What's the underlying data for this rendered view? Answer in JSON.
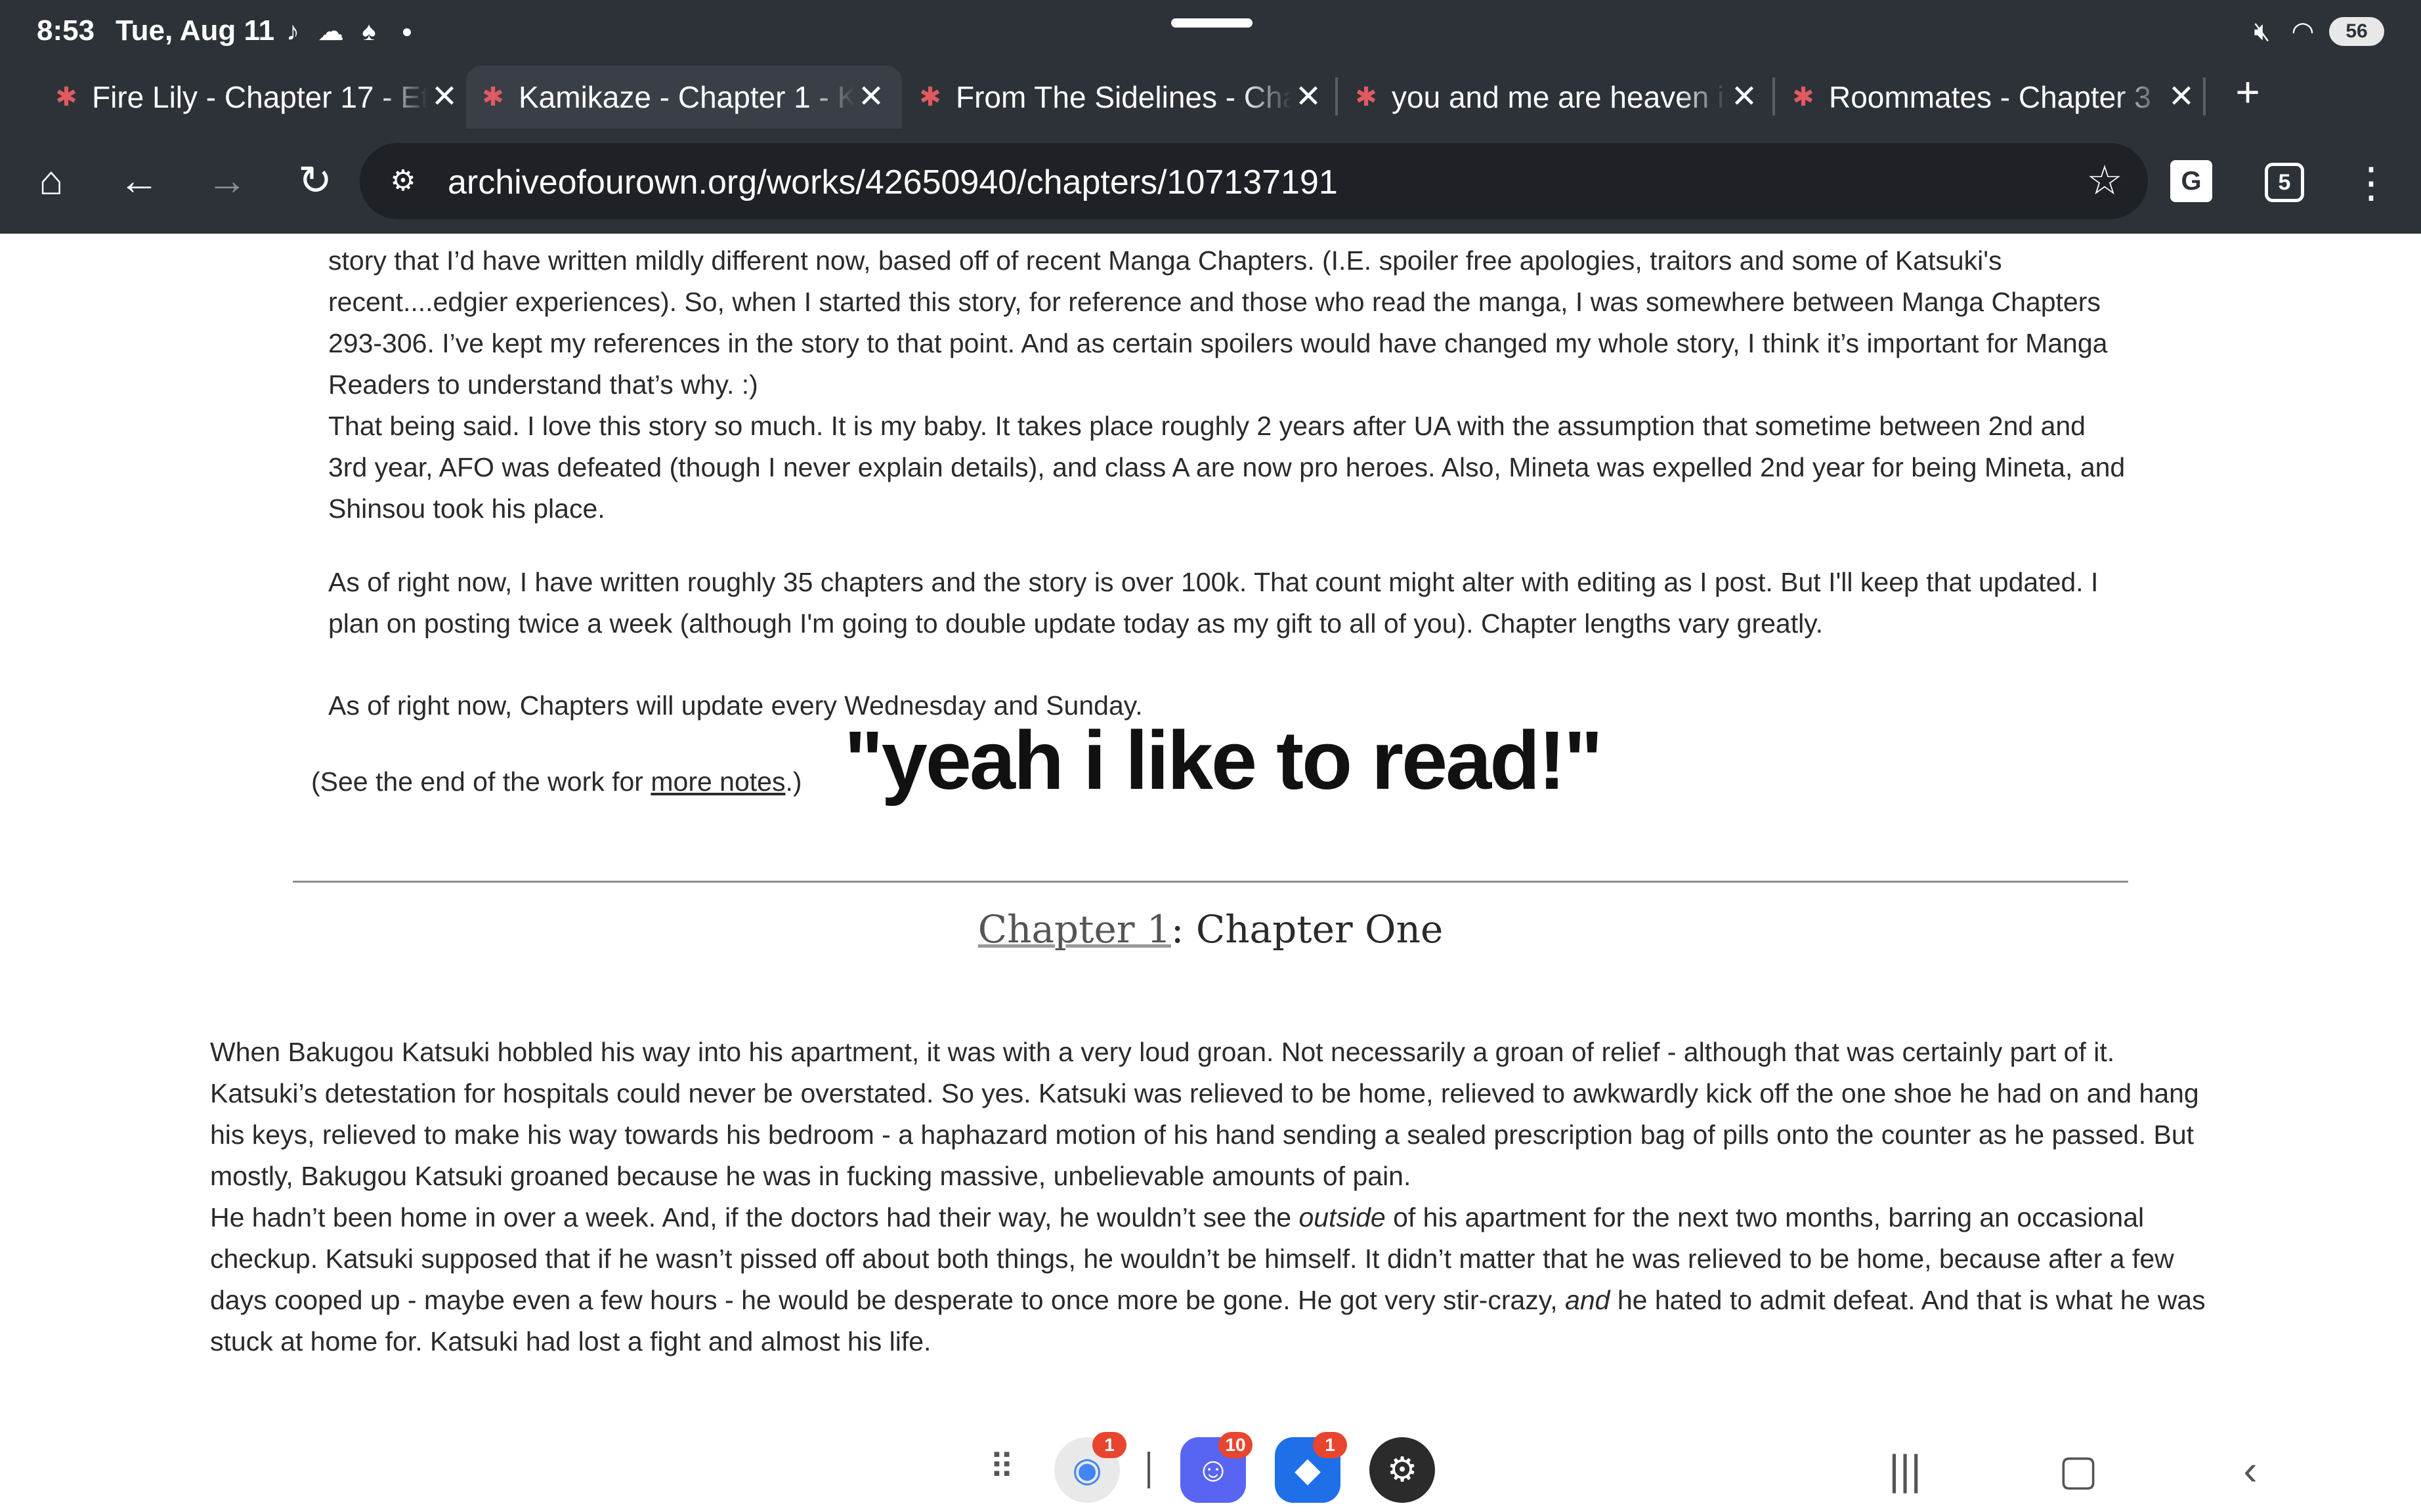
{
  "status_bar": {
    "time": "8:53",
    "date": "Tue, Aug 11",
    "battery": "56"
  },
  "tabs": [
    {
      "title": "Fire Lily - Chapter 17 - Et"
    },
    {
      "title": "Kamikaze - Chapter 1 - K"
    },
    {
      "title": "From The Sidelines - Cha"
    },
    {
      "title": "you and me are heaven in"
    },
    {
      "title": "Roommates - Chapter 3"
    }
  ],
  "toolbar": {
    "url": "archiveofourown.org/works/42650940/chapters/107137191",
    "tab_count": "5"
  },
  "notes": {
    "paragraphs": [
      "story that I’d have written mildly different now, based off of recent Manga Chapters. (I.E. spoiler free apologies, traitors and some of Katsuki's recent....edgier experiences). So, when I started this story, for reference and those who read the manga, I was somewhere between Manga Chapters 293-306. I’ve kept my references in the story to that point. And as certain spoilers would have changed my whole story, I think it’s important for Manga Readers to understand that’s why. :)",
      "That being said. I love this story so much. It is my baby. It takes place roughly 2 years after UA with the assumption that sometime between 2nd and 3rd year, AFO was defeated (though I never explain details), and class A are now pro heroes. Also, Mineta was expelled 2nd year for being Mineta, and Shinsou took his place.",
      "As of right now, I have written roughly 35 chapters and the story is over 100k. That count might alter with editing as I post. But I'll keep that updated. I plan on posting twice a week (although I'm going to double update today as my gift to all of you). Chapter lengths vary greatly.",
      "As of right now, Chapters will update every Wednesday and Sunday."
    ],
    "see_end_prefix": "(See the end of the work for ",
    "see_end_link": "more notes",
    "see_end_suffix": ".)"
  },
  "overlay_caption": "\"yeah i like to read!\"",
  "chapter": {
    "link": "Chapter 1",
    "title": ": Chapter One"
  },
  "body": {
    "p1": "When Bakugou Katsuki hobbled his way into his apartment, it was with a very loud groan. Not necessarily a groan of relief - although that was certainly part of it. Katsuki’s detestation for hospitals could never be overstated. So yes. Katsuki was relieved to be home, relieved to awkwardly kick off the one shoe he had on and hang his keys, relieved to make his way towards his bedroom - a haphazard motion of his hand sending a sealed prescription bag of pills onto the counter as he passed. But mostly, Bakugou Katsuki groaned because he was in fucking massive, unbelievable amounts of pain.",
    "p2_a": "He hadn’t been home in over a week. And, if the doctors had their way, he wouldn’t see the ",
    "p2_em1": "outside",
    "p2_b": " of his apartment for the next two months, barring an occasional checkup. Katsuki supposed that if he wasn’t pissed off about both things, he wouldn’t be himself. It didn’t matter that he was relieved to be home, because after a few days cooped up - maybe even a few hours - he would be desperate to once more be gone. He got very stir-crazy, ",
    "p2_em2": "and",
    "p2_c": " he hated to admit defeat. And that is what he was stuck at home for. Katsuki had lost a fight and almost his life."
  },
  "dock": {
    "chrome_badge": "1",
    "discord_badge": "10",
    "roblox_badge": "1"
  },
  "colors": {
    "chrome_bg": "#2d3138",
    "url_bg": "#1e2125",
    "badge": "#e8452f"
  }
}
